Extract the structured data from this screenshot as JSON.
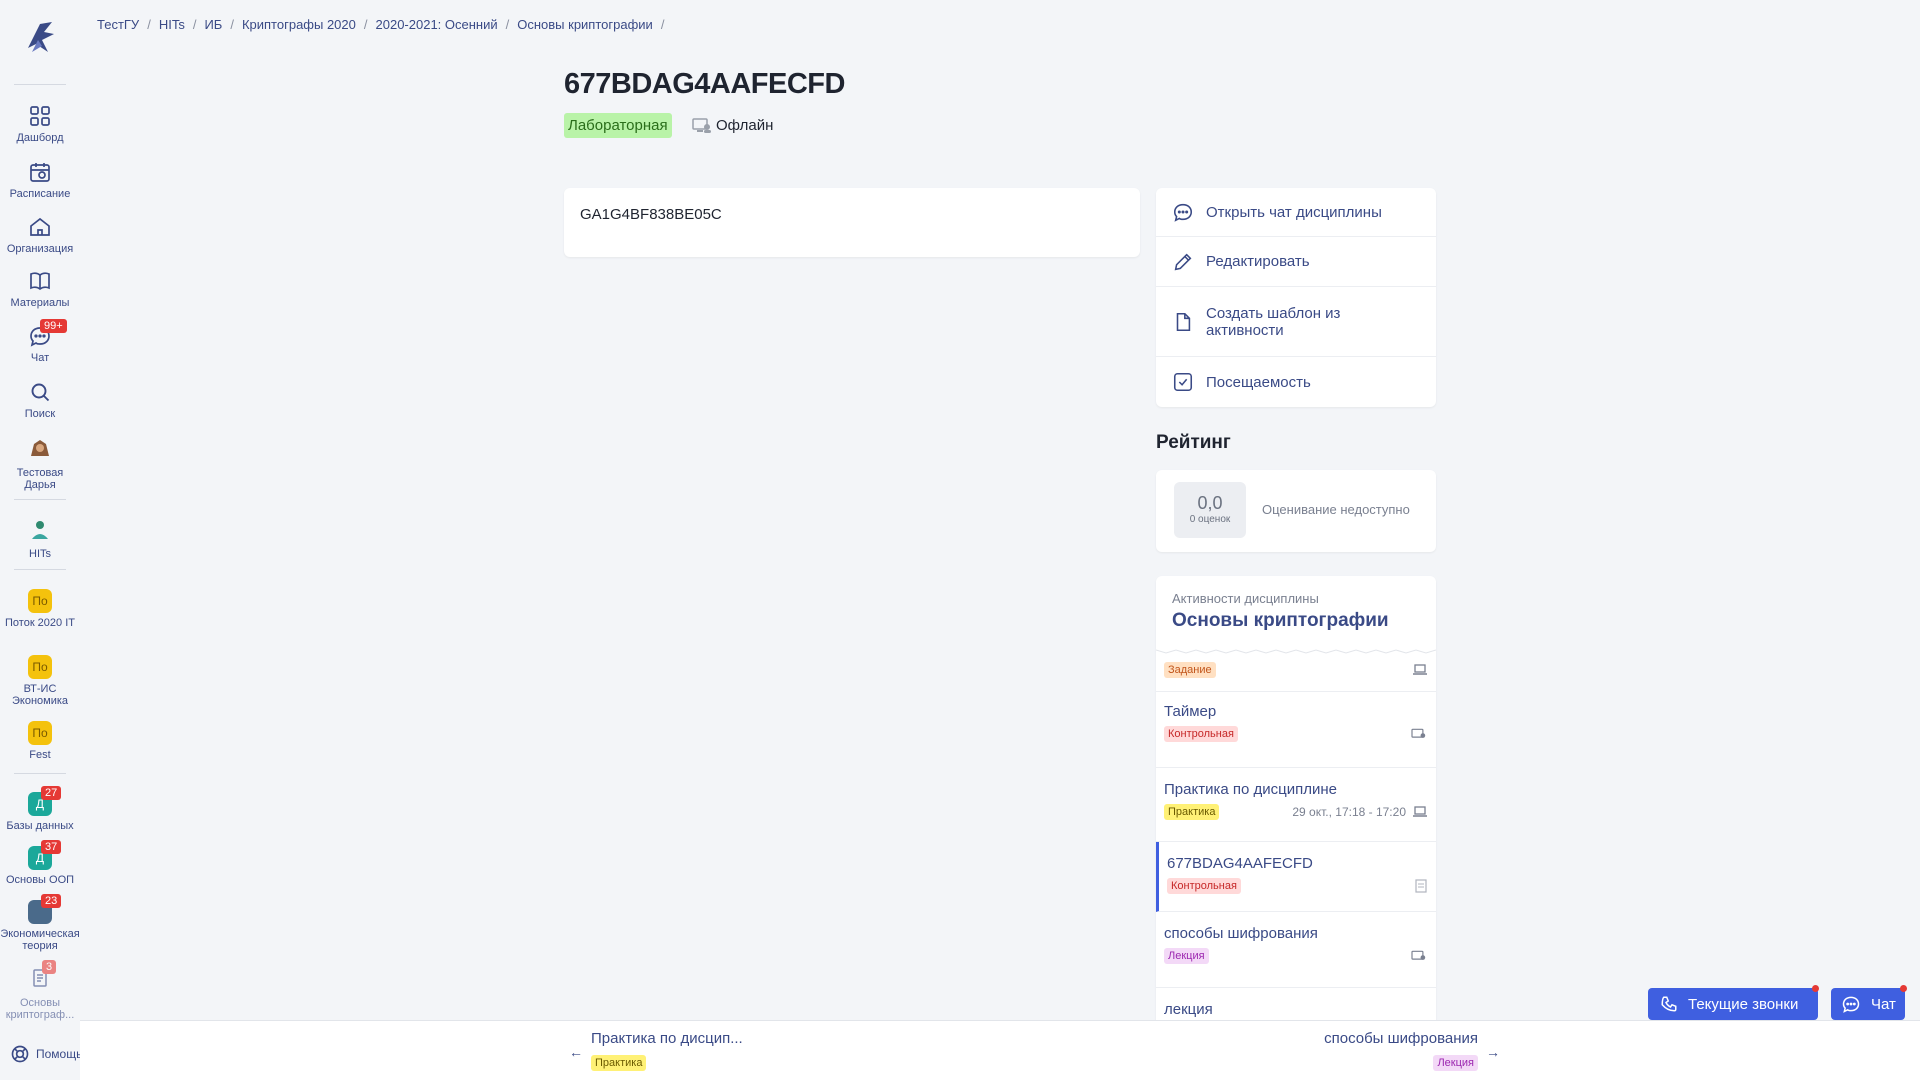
{
  "sidebar": {
    "items": [
      {
        "label": "Дашборд",
        "icon": "dashboard-icon"
      },
      {
        "label": "Расписание",
        "icon": "calendar-icon"
      },
      {
        "label": "Организация",
        "icon": "home-icon"
      },
      {
        "label": "Материалы",
        "icon": "book-icon"
      },
      {
        "label": "Чат",
        "icon": "chat-icon",
        "badge": "99+"
      },
      {
        "label": "Поиск",
        "icon": "search-icon"
      },
      {
        "label": "Тестовая Дарья",
        "icon": "user-avatar"
      }
    ],
    "org": {
      "label": "HITs"
    },
    "groups": [
      {
        "letter": "По",
        "label": "Поток 2020 IT"
      },
      {
        "letter": "По",
        "label": "ВТ-ИС Экономика"
      },
      {
        "letter": "По",
        "label": "Fest"
      }
    ],
    "courses": [
      {
        "letter": "Д",
        "label": "Базы данных",
        "badge": "27"
      },
      {
        "letter": "Д",
        "label": "Основы ООП",
        "badge": "37"
      },
      {
        "letter": "",
        "label": "Экономическая теория",
        "badge": "23"
      },
      {
        "letter": "",
        "label": "Основы криптограф...",
        "badge": "3"
      }
    ],
    "help": "Помощь"
  },
  "breadcrumb": [
    "ТестГУ",
    "HITs",
    "ИБ",
    "Криптографы 2020",
    "2020-2021: Осенний",
    "Основы криптографии"
  ],
  "page": {
    "title": "677BDAG4AAFECFD",
    "type": "Лабораторная",
    "mode": "Офлайн",
    "content": "GA1G4BF838BE05C"
  },
  "actions": [
    {
      "label": "Открыть чат дисциплины",
      "icon": "chat-icon"
    },
    {
      "label": "Редактировать",
      "icon": "pencil-icon"
    },
    {
      "label": "Создать шаблон из активности",
      "icon": "file-icon"
    },
    {
      "label": "Посещаемость",
      "icon": "checkbox-icon"
    }
  ],
  "rating": {
    "title": "Рейтинг",
    "value": "0,0",
    "count": "0 оценок",
    "note": "Оценивание недоступно"
  },
  "activities": {
    "subtitle": "Активности дисциплины",
    "title": "Основы криптографии",
    "items": [
      {
        "name": "",
        "tag": "Задание",
        "tag_color": "orange",
        "meta": "",
        "icon": "laptop-icon"
      },
      {
        "name": "Таймер",
        "tag": "Контрольная",
        "tag_color": "red",
        "meta": "",
        "icon": "offline-icon"
      },
      {
        "name": "Практика по дисциплине",
        "tag": "Практика",
        "tag_color": "yellow",
        "meta": "29 окт., 17:18 - 17:20",
        "icon": "laptop-icon"
      },
      {
        "name": "677BDAG4AAFECFD",
        "tag": "Контрольная",
        "tag_color": "red",
        "meta": "",
        "icon": "document-icon"
      },
      {
        "name": "способы шифрования",
        "tag": "Лекция",
        "tag_color": "purple",
        "meta": "",
        "icon": "offline-icon"
      },
      {
        "name": "лекция",
        "tag": "",
        "tag_color": "",
        "meta": "",
        "icon": ""
      }
    ]
  },
  "pager": {
    "prev": {
      "name": "Практика по дисцип...",
      "tag": "Практика"
    },
    "next": {
      "name": "способы шифрования",
      "tag": "Лекция"
    }
  },
  "floating": {
    "calls": "Текущие звонки",
    "chat": "Чат"
  },
  "colors": {
    "accent": "#3f5fe0",
    "link": "#3a4a86",
    "badge": "#e53935"
  }
}
